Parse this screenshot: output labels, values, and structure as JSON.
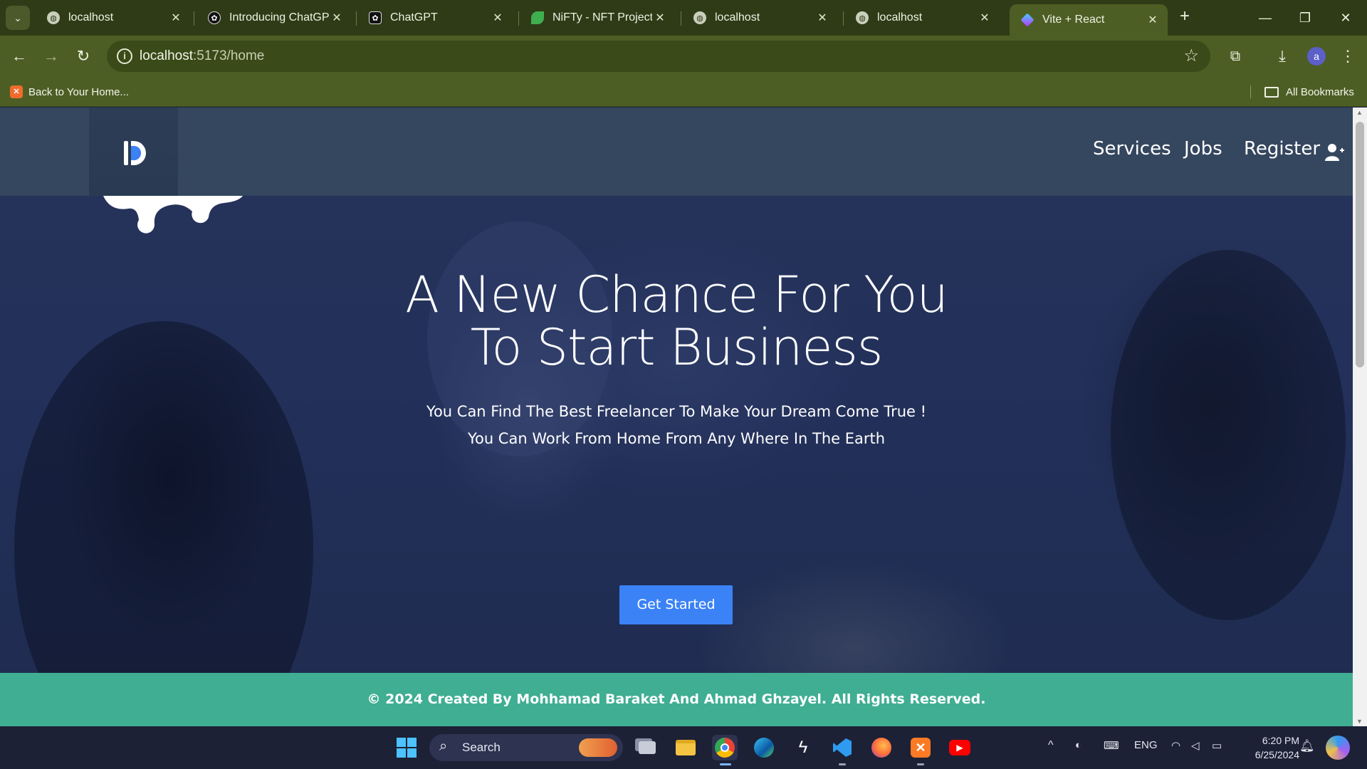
{
  "browser": {
    "tabs": [
      {
        "title": "localhost",
        "active": false
      },
      {
        "title": "Introducing ChatGPT",
        "active": false
      },
      {
        "title": "ChatGPT",
        "active": false
      },
      {
        "title": "NiFTy - NFT Project &",
        "active": false
      },
      {
        "title": "localhost",
        "active": false
      },
      {
        "title": "localhost",
        "active": false
      },
      {
        "title": "Vite + React",
        "active": true
      }
    ],
    "address_host": "localhost",
    "address_path": ":5173/home",
    "profile_initial": "a",
    "bookmarks": {
      "item": "Back to Your Home...",
      "all_bookmarks": "All Bookmarks"
    }
  },
  "site": {
    "nav": {
      "services": "Services",
      "jobs": "Jobs",
      "register": "Register"
    },
    "hero": {
      "title_line1": "A New Chance For You",
      "title_line2": "To Start Business",
      "subtitle_line1": "You Can Find The Best Freelancer To Make Your Dream Come True !",
      "subtitle_line2": "You Can Work From Home From Any Where In The Earth",
      "cta": "Get Started"
    },
    "footer": "© 2024 Created By Mohhamad Baraket And Ahmad Ghzayel. All Rights Reserved."
  },
  "taskbar": {
    "search_label": "Search",
    "language": "ENG",
    "time": "6:20 PM",
    "date": "6/25/2024"
  },
  "colors": {
    "chrome_frame": "#2f3b17",
    "chrome_toolbar": "#4d5e25",
    "header": "#35465f",
    "cta": "#3b82f6",
    "footer": "#3fae93"
  }
}
